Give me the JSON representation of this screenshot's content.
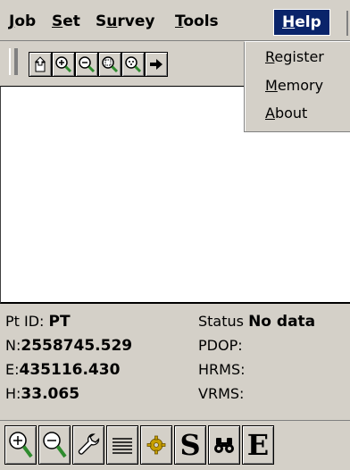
{
  "menubar": {
    "items": [
      {
        "label_ul": "J",
        "label_rest": "ob"
      },
      {
        "label_ul": "S",
        "label_rest": "et"
      },
      {
        "label_pre": "S",
        "label_ul": "u",
        "label_rest": "rvey"
      },
      {
        "label_ul": "T",
        "label_rest": "ools"
      },
      {
        "label_ul": "H",
        "label_rest": "elp"
      }
    ]
  },
  "help_menu": {
    "items": [
      {
        "label_ul": "R",
        "label_rest": "egister"
      },
      {
        "label_ul": "M",
        "label_rest": "emory"
      },
      {
        "label_ul": "A",
        "label_rest": "bout"
      }
    ]
  },
  "info": {
    "pt_id_label": "Pt ID:",
    "pt_id_value": "PT",
    "n_label": "N:",
    "n_value": "2558745.529",
    "e_label": "E:",
    "e_value": "435116.430",
    "h_label": "H:",
    "h_value": "33.065",
    "status_label": "Status",
    "status_value": "No data",
    "pdop_label": "PDOP:",
    "hrms_label": "HRMS:",
    "vrms_label": "VRMS:"
  },
  "bottombar": {
    "s_label": "S",
    "e_label": "E"
  },
  "icons": {
    "toolbar": [
      "job-icon",
      "zoom-in-icon",
      "zoom-out-icon",
      "zoom-window-icon",
      "zoom-extents-icon",
      "arrow-right-icon"
    ],
    "bottom": [
      "zoom-in-icon",
      "zoom-out-icon",
      "wrench-icon",
      "list-icon",
      "gear-icon",
      "stakeout-icon",
      "binoculars-icon",
      "edit-icon"
    ]
  },
  "colors": {
    "menu_highlight": "#0a246a",
    "magnifier_handle": "#2e8b2e"
  }
}
